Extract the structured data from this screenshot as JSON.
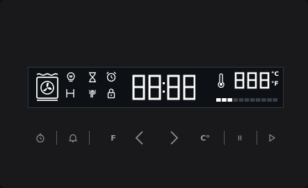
{
  "display": {
    "clock_digits": "88:88",
    "temperature_digits": "888",
    "unit_celsius": "°C",
    "unit_fahrenheit": "°F",
    "heat_level_segments_on": 3,
    "heat_level_segments_total": 11,
    "icons": {
      "oven": "oven-fan-icon",
      "row1": [
        "light-bulb-icon",
        "hourglass-icon",
        "alarm-clock-icon"
      ],
      "row2": [
        "rack-icon",
        "probe-icon",
        "lock-icon"
      ],
      "thermometer": "thermometer-icon"
    }
  },
  "controls": {
    "timer": "timer-icon",
    "bell": "bell-icon",
    "function_label": "F",
    "prev": "chevron-left-icon",
    "next": "chevron-right-icon",
    "temperature_label": "C°",
    "pause": "pause-icon",
    "play": "play-icon"
  },
  "colors": {
    "lcd_text": "#ffffff",
    "lcd_dim": "#3a4046",
    "lcd_border": "#2a3a44",
    "buttons": "#8e8e95"
  }
}
